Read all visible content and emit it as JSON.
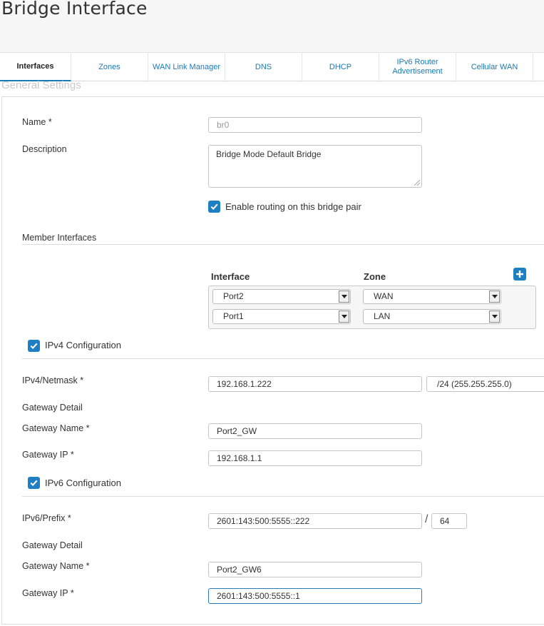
{
  "page": {
    "title": "Bridge Interface"
  },
  "tabs": [
    {
      "label": "Interfaces"
    },
    {
      "label": "Zones"
    },
    {
      "label": "WAN Link Manager"
    },
    {
      "label": "DNS"
    },
    {
      "label": "DHCP"
    },
    {
      "label": "IPv6 Router Advertisement"
    },
    {
      "label": "Cellular WAN"
    }
  ],
  "general": {
    "section_title": "General Settings",
    "name_label": "Name *",
    "name_value": "br0",
    "description_label": "Description",
    "description_value": "Bridge Mode Default Bridge",
    "routing_label": "Enable routing on this bridge pair"
  },
  "members": {
    "section_title": "Member Interfaces",
    "interface_header": "Interface",
    "zone_header": "Zone",
    "rows": [
      {
        "interface": "Port2",
        "zone": "WAN"
      },
      {
        "interface": "Port1",
        "zone": "LAN"
      }
    ]
  },
  "ipv4": {
    "toggle_label": "IPv4 Configuration",
    "netmask_label": "IPv4/Netmask *",
    "address": "192.168.1.222",
    "netmask": "/24 (255.255.255.0)",
    "gateway_detail": "Gateway Detail",
    "gateway_name_label": "Gateway Name  *",
    "gateway_name": "Port2_GW",
    "gateway_ip_label": "Gateway IP  *",
    "gateway_ip": "192.168.1.1"
  },
  "ipv6": {
    "toggle_label": "IPv6 Configuration",
    "prefix_label": "IPv6/Prefix *",
    "address": "2601:143:500:5555::222",
    "separator": "/",
    "prefix": "64",
    "gateway_detail": "Gateway Detail",
    "gateway_name_label": "Gateway Name *",
    "gateway_name": "Port2_GW6",
    "gateway_ip_label": "Gateway IP *",
    "gateway_ip": "2601:143:500:5555::1"
  },
  "colors": {
    "accent": "#1e7fc2",
    "tab_text": "#1a7ab8"
  },
  "icons": {
    "checkbox": "checkmark-icon",
    "add": "plus-icon",
    "dropdown": "chevron-down-icon"
  }
}
